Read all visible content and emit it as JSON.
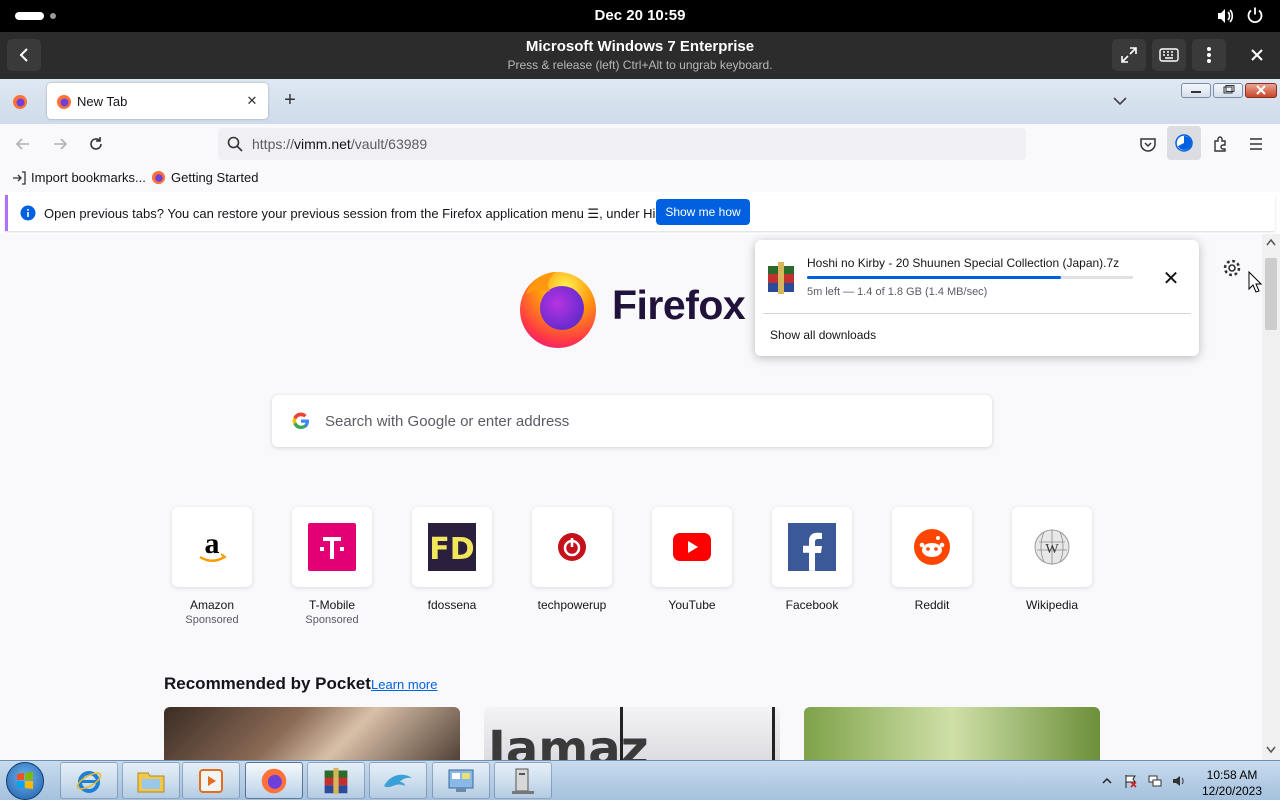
{
  "gnome": {
    "clock": "Dec 20  10:59"
  },
  "viewer": {
    "title": "Microsoft Windows 7 Enterprise",
    "subtitle": "Press & release (left) Ctrl+Alt to ungrab keyboard."
  },
  "browser": {
    "tab": {
      "title": "New Tab"
    },
    "url": {
      "prefix": "https://",
      "host": "vimm.net",
      "path": "/vault/63989"
    },
    "bookmarks": [
      {
        "label": "Import bookmarks..."
      },
      {
        "label": "Getting Started"
      }
    ],
    "notification": {
      "text": "Open previous tabs? You can restore your previous session from the Firefox application menu ☰, under History.",
      "button": "Show me how"
    }
  },
  "newtab": {
    "logo_text": "Firefox",
    "search_placeholder": "Search with Google or enter address",
    "shortcuts": [
      {
        "label": "Amazon",
        "sub": "Sponsored",
        "icon": "amazon-icon"
      },
      {
        "label": "T-Mobile",
        "sub": "Sponsored",
        "icon": "tmobile-icon"
      },
      {
        "label": "fdossena",
        "sub": "",
        "icon": "fdossena-icon"
      },
      {
        "label": "techpowerup",
        "sub": "",
        "icon": "techpowerup-icon"
      },
      {
        "label": "YouTube",
        "sub": "",
        "icon": "youtube-icon"
      },
      {
        "label": "Facebook",
        "sub": "",
        "icon": "facebook-icon"
      },
      {
        "label": "Reddit",
        "sub": "",
        "icon": "reddit-icon"
      },
      {
        "label": "Wikipedia",
        "sub": "",
        "icon": "wikipedia-icon"
      }
    ],
    "pocket": {
      "title": "Recommended by Pocket",
      "learn_more": "Learn more"
    }
  },
  "download": {
    "filename": "Hoshi no Kirby - 20 Shuunen Special Collection (Japan).7z",
    "status": "5m left — 1.4 of 1.8 GB (1.4 MB/sec)",
    "progress": 0.78,
    "show_all": "Show all downloads"
  },
  "taskbar": {
    "time": "10:58 AM",
    "date": "12/20/2023"
  }
}
